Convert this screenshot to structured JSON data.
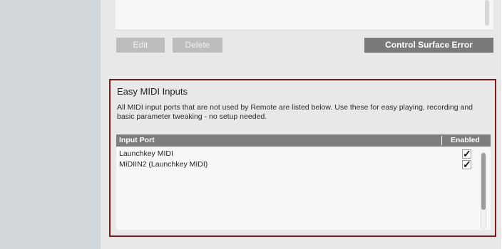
{
  "buttons": {
    "edit": "Edit",
    "delete": "Delete",
    "control_surface_error": "Control Surface Error"
  },
  "easy_midi": {
    "title": "Easy MIDI Inputs",
    "description": "All MIDI input ports that are not used by Remote are listed below. Use these for easy playing, recording and basic parameter tweaking - no setup needed.",
    "columns": {
      "port": "Input Port",
      "enabled": "Enabled"
    },
    "rows": [
      {
        "port": "Launchkey MIDI",
        "enabled": "✓"
      },
      {
        "port": "MIDIIN2 (Launchkey MIDI)",
        "enabled": "✓"
      }
    ]
  },
  "colors": {
    "highlight_border": "#7a1a1a",
    "error_button": "#7a7a7a",
    "table_header": "#7d7d7d"
  }
}
